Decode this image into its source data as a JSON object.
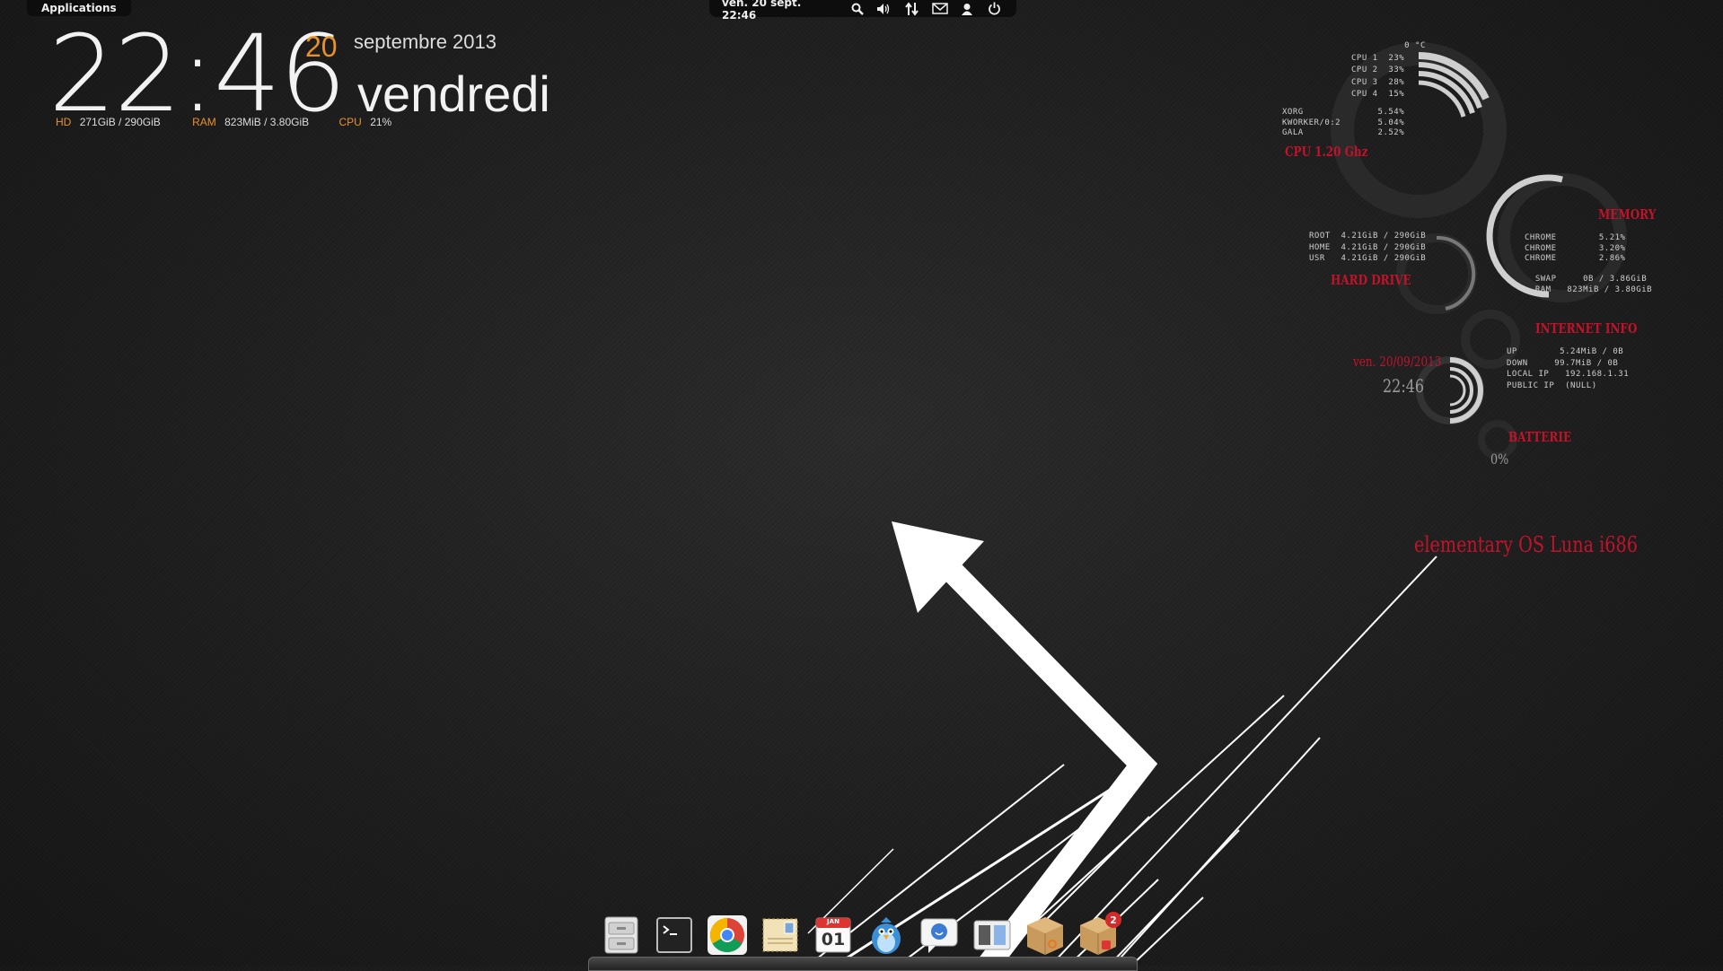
{
  "panel": {
    "applications_label": "Applications",
    "datetime": "ven. 20 sept. 22:46"
  },
  "clock_widget": {
    "time": "22:46",
    "day": "20",
    "month_year": "septembre 2013",
    "weekday": "vendredi",
    "hd_label": "HD",
    "hd_value": "271GiB / 290GiB",
    "ram_label": "RAM",
    "ram_value": "823MiB / 3.80GiB",
    "cpu_label": "CPU",
    "cpu_value": "21%"
  },
  "conky": {
    "cpu_block": "          0 °C\nCPU 1  23%\nCPU 2  33%\nCPU 3  28%\nCPU 4  15%",
    "proc_block": "XORG              5.54%\nKWORKER/0:2       5.04%\nGALA              2.52%",
    "cpu_title": "CPU  1.20 Ghz",
    "memory_title": "MEMORY",
    "memory_block": "CHROME        5.21%\nCHROME        3.20%\nCHROME        2.86%\n\n  SWAP     0B / 3.86GiB\n  RAM   823MiB / 3.80GiB",
    "hd_block": "ROOT  4.21GiB / 290GiB\nHOME  4.21GiB / 290GiB\nUSR   4.21GiB / 290GiB",
    "hd_title": "HARD DRIVE",
    "net_title": "INTERNET INFO",
    "net_block": "UP        5.24MiB / 0B\nDOWN     99.7MiB / 0B\nLOCAL IP   192.168.1.31\nPUBLIC IP  (NULL)",
    "date": "ven. 20/09/2013",
    "time": "22:46",
    "battery_title": "BATTERIE",
    "battery_value": "0%",
    "os": "elementary OS Luna  i686"
  },
  "dock": {
    "calendar_month": "JAN",
    "calendar_day": "01",
    "badge_count": "2"
  }
}
